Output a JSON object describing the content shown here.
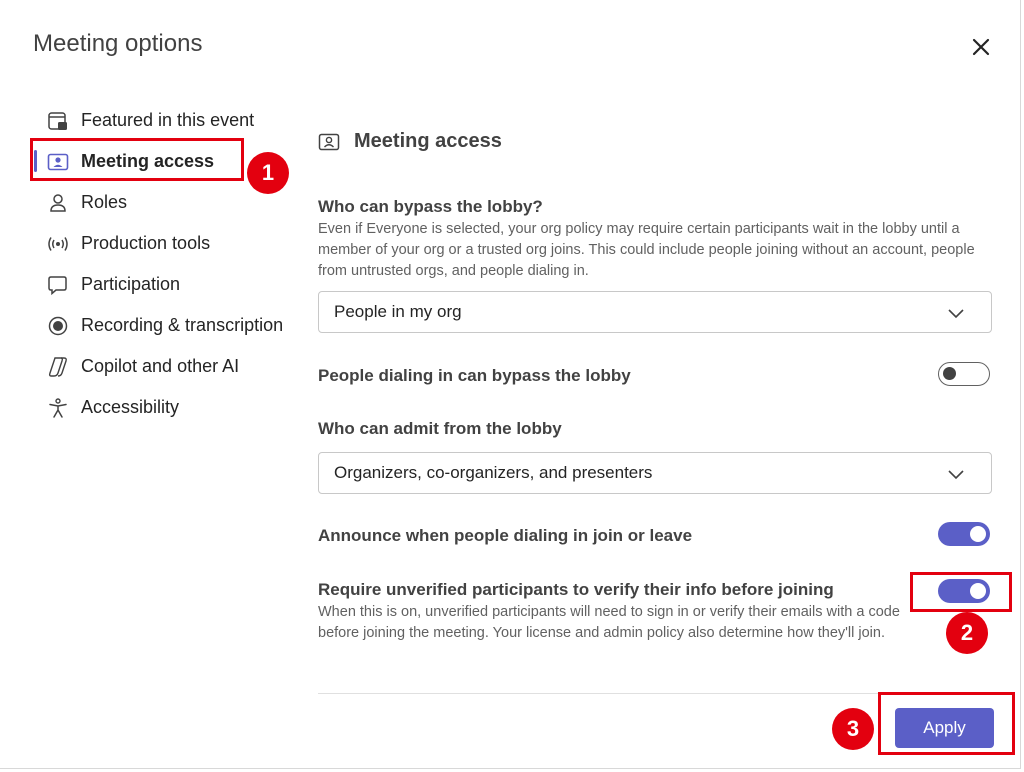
{
  "dialog": {
    "title": "Meeting options"
  },
  "sidebar": {
    "items": [
      {
        "label": "Featured in this event",
        "icon": "calendar-featured-icon"
      },
      {
        "label": "Meeting access",
        "icon": "person-card-icon",
        "active": true
      },
      {
        "label": "Roles",
        "icon": "person-icon"
      },
      {
        "label": "Production tools",
        "icon": "broadcast-icon"
      },
      {
        "label": "Participation",
        "icon": "chat-icon"
      },
      {
        "label": "Recording & transcription",
        "icon": "record-icon"
      },
      {
        "label": "Copilot and other AI",
        "icon": "copilot-icon"
      },
      {
        "label": "Accessibility",
        "icon": "accessibility-icon"
      }
    ]
  },
  "main": {
    "section_title": "Meeting access",
    "bypass_lobby": {
      "label": "Who can bypass the lobby?",
      "description": "Even if Everyone is selected, your org policy may require certain participants wait in the lobby until a member of your org or a trusted org joins. This could include people joining without an account, people from untrusted orgs, and people dialing in.",
      "selected": "People in my org"
    },
    "dial_in_bypass": {
      "label": "People dialing in can bypass the lobby",
      "enabled": false
    },
    "admit_from_lobby": {
      "label": "Who can admit from the lobby",
      "selected": "Organizers, co-organizers, and presenters"
    },
    "announce_dial_in": {
      "label": "Announce when people dialing in join or leave",
      "enabled": true
    },
    "verify_unverified": {
      "label": "Require unverified participants to verify their info before joining",
      "description": "When this is on, unverified participants will need to sign in or verify their emails with a code before joining the meeting. Your license and admin policy also determine how they'll join.",
      "enabled": true
    },
    "apply_label": "Apply"
  },
  "annotations": {
    "badge_1": "1",
    "badge_2": "2",
    "badge_3": "3",
    "highlight_color": "#e3000f"
  },
  "colors": {
    "accent": "#5b5fc7",
    "text": "#242424",
    "muted": "#616161"
  }
}
